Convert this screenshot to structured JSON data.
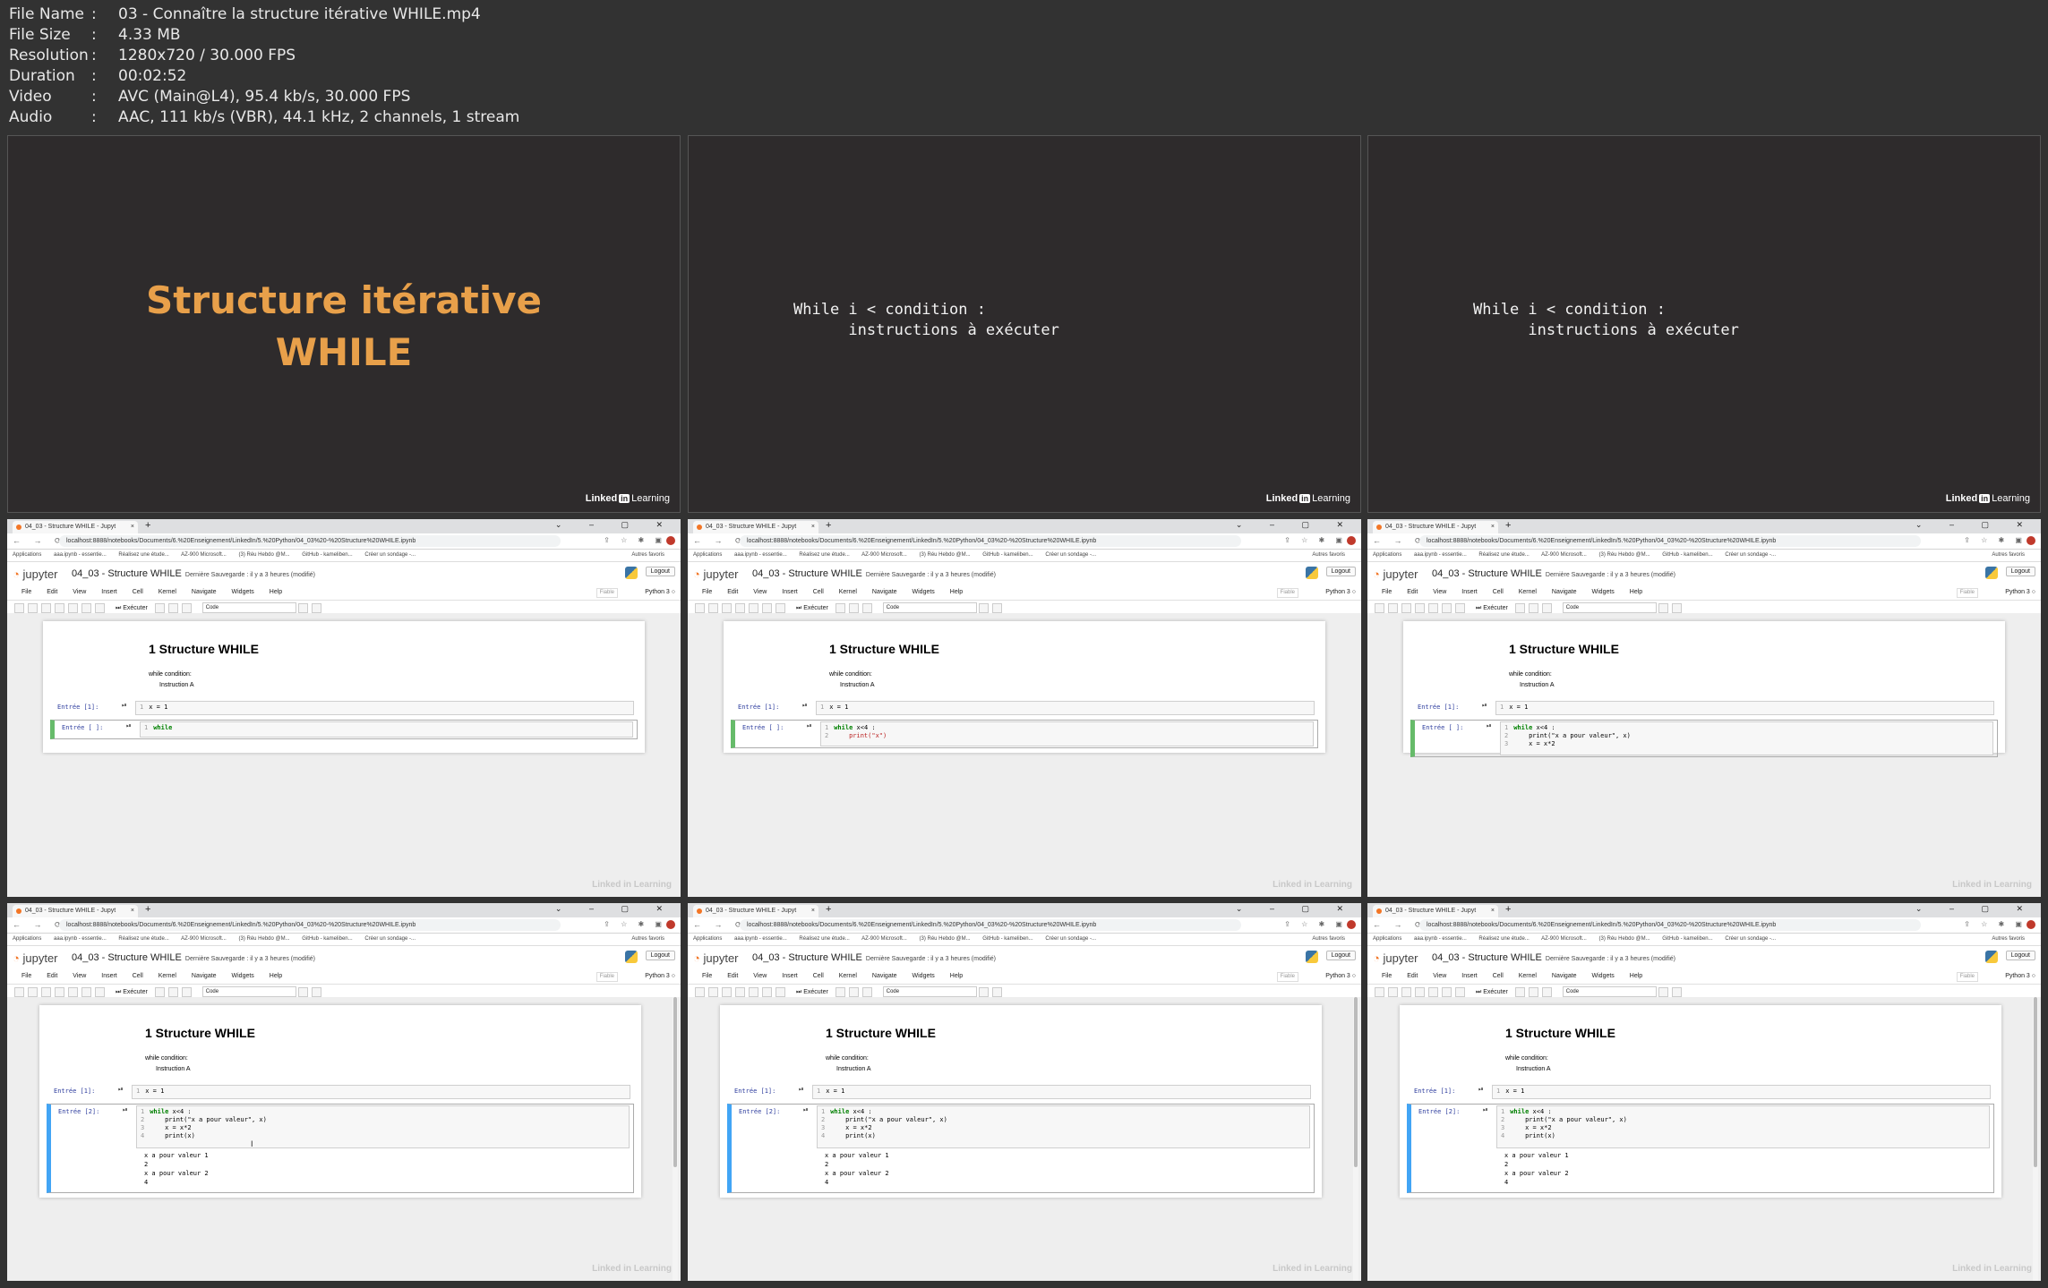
{
  "file_info": [
    {
      "key": "File Name",
      "value": "03 - Connaître la structure itérative WHILE.mp4"
    },
    {
      "key": "File Size",
      "value": "4.33 MB"
    },
    {
      "key": "Resolution",
      "value": "1280x720 / 30.000 FPS"
    },
    {
      "key": "Duration",
      "value": "00:02:52"
    },
    {
      "key": "Video",
      "value": "AVC (Main@L4), 95.4 kb/s, 30.000 FPS"
    },
    {
      "key": "Audio",
      "value": "AAC, 111 kb/s (VBR), 44.1 kHz, 2 channels, 1 stream"
    }
  ],
  "info_sep": ":",
  "slides": {
    "title_line1": "Structure itérative",
    "title_line2": "WHILE",
    "code_line1": "While i < condition :",
    "code_line2": "      instructions à exécuter",
    "logo_left": "Linked",
    "logo_in": "in",
    "logo_right": " Learning"
  },
  "browser": {
    "tab_title": "04_03 - Structure WHILE - Jupyt",
    "tab_close": "×",
    "new_tab": "+",
    "window_controls": "⌄ – ▢ ✕",
    "nav_icons": "← → ⟳ ⌂",
    "url": "localhost:8888/notebooks/Documents/6.%20Enseignement/LinkedIn/5.%20Python/04_03%20-%20Structure%20WHILE.ipynb",
    "ext_icons": "⇪ ☆ ✱ ▣",
    "bookmarks": [
      "Applications",
      "aaa.ipynb - essentie...",
      "Réalisez une étude...",
      "AZ-900 Microsoft...",
      "(3) Réu Hebdo @M...",
      "GitHub - kameliben...",
      "Créer un sondage -..."
    ],
    "bookmarks_right": "Autres favoris"
  },
  "jupyter": {
    "logo": "jupyter",
    "notebook_name": "04_03 - Structure WHILE",
    "save_meta": "Dernière Sauvegarde : il y a 3 heures  (modifié)",
    "logout": "Logout",
    "menus": [
      "File",
      "Edit",
      "View",
      "Insert",
      "Cell",
      "Kernel",
      "Navigate",
      "Widgets",
      "Help"
    ],
    "trusted": "Fiable",
    "kernel": "Python 3 ○",
    "run_label": "⏭ Exécuter",
    "cell_type": "Code",
    "heading": "1  Structure WHILE",
    "md_line1": "while condition:",
    "md_line2": "Instruction A",
    "prompt1": "Entrée [1]:",
    "prompt_empty": "Entrée [ ]:",
    "prompt2": "Entrée [2]:",
    "run_icon": "⏯",
    "watermark": "Linked in Learning"
  },
  "frames": [
    {
      "cell1_ln": "1",
      "cell1_code": "x = 1",
      "cell2_lines": [
        {
          "ln": "1",
          "kw": "while",
          "rest": ""
        }
      ]
    },
    {
      "cell2_lines": [
        {
          "ln": "1",
          "kw": "while",
          "rest": " x<4 :"
        },
        {
          "ln": "2",
          "kw": "",
          "rest": "    print(\"x\")"
        }
      ]
    },
    {
      "cell2_lines": [
        {
          "ln": "1",
          "kw": "while",
          "rest": " x<4 :"
        },
        {
          "ln": "2",
          "kw": "",
          "rest": "    print(\"x a pour valeur\", x)"
        },
        {
          "ln": "3",
          "kw": "",
          "rest": "    x = x*2"
        }
      ]
    },
    {
      "cell2_lines": [
        {
          "ln": "1",
          "kw": "while",
          "rest": " x<4 :"
        },
        {
          "ln": "2",
          "kw": "",
          "rest": "    print(\"x a pour valeur\", x)"
        },
        {
          "ln": "3",
          "kw": "",
          "rest": "    x = x*2"
        },
        {
          "ln": "4",
          "kw": "",
          "rest": "    print(x)"
        }
      ],
      "output": "x a pour valeur 1\n2\nx a pour valeur 2\n4"
    }
  ]
}
